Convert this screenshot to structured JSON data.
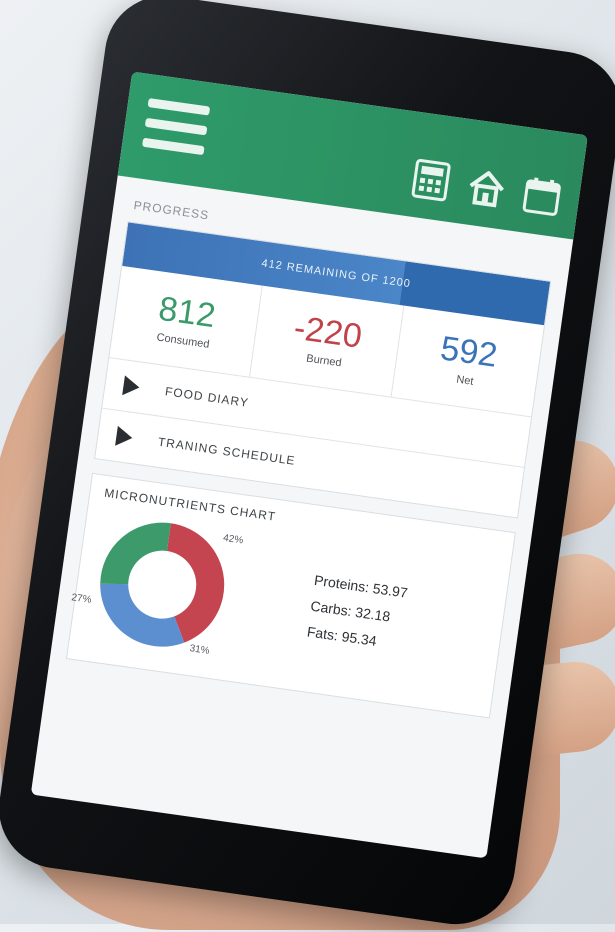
{
  "header": {
    "menu_icon": "hamburger-menu-icon",
    "icons": [
      {
        "name": "calculator-icon"
      },
      {
        "name": "home-icon"
      },
      {
        "name": "calendar-icon"
      }
    ],
    "color": "#2f9b6a"
  },
  "progress": {
    "section_title": "PROGRESS",
    "bar_text": "412 REMAINING OF 1200",
    "remaining": 412,
    "goal": 1200
  },
  "stats": [
    {
      "value": "812",
      "label": "Consumed",
      "color": "#3a9a6a"
    },
    {
      "value": "-220",
      "label": "Burned",
      "color": "#c0424a"
    },
    {
      "value": "592",
      "label": "Net",
      "color": "#3a73b8"
    }
  ],
  "nav": [
    {
      "label": "FOOD DIARY"
    },
    {
      "label": "TRANING SCHEDULE"
    }
  ],
  "micronutrients": {
    "title": "MICRONUTRIENTS CHART",
    "chart_data": {
      "type": "pie",
      "slices": [
        {
          "value": 42,
          "label": "42%",
          "color": "#c4454f"
        },
        {
          "value": 31,
          "label": "31%",
          "color": "#5b8fd0"
        },
        {
          "value": 27,
          "label": "27%",
          "color": "#3c9a6b"
        }
      ]
    },
    "macros": [
      {
        "text": "Proteins: 53.97"
      },
      {
        "text": "Carbs: 32.18"
      },
      {
        "text": "Fats: 95.34"
      }
    ]
  }
}
